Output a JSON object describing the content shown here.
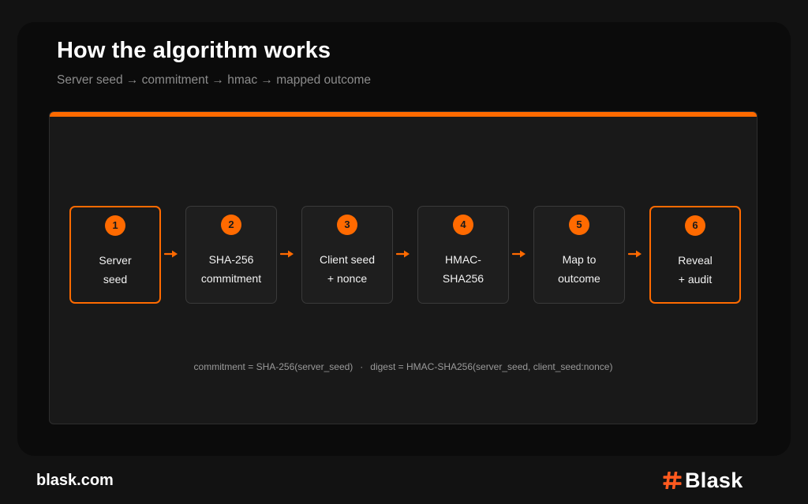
{
  "header": {
    "title": "How the algorithm works",
    "subtitle": "Server seed → commitment → hmac → mapped outcome"
  },
  "colors": {
    "accent": "#ff6a00",
    "background": "#121212",
    "card": "#0b0b0b",
    "panel": "#191919"
  },
  "steps": [
    {
      "number": "1",
      "line1": "Server",
      "line2": "seed",
      "highlight": true
    },
    {
      "number": "2",
      "line1": "SHA-256",
      "line2": "commitment",
      "highlight": false
    },
    {
      "number": "3",
      "line1": "Client seed",
      "line2": "+ nonce",
      "highlight": false
    },
    {
      "number": "4",
      "line1": "HMAC-",
      "line2": "SHA256",
      "highlight": false
    },
    {
      "number": "5",
      "line1": "Map to",
      "line2": "outcome",
      "highlight": false
    },
    {
      "number": "6",
      "line1": "Reveal",
      "line2": "+ audit",
      "highlight": true
    }
  ],
  "formula": {
    "commitment": "commitment = SHA-256(server_seed)",
    "separator": "·",
    "digest": "digest = HMAC-SHA256(server_seed, client_seed:nonce)"
  },
  "footer": {
    "site": "blask.com",
    "logo_text": "Blask",
    "logo_icon": "hash-icon"
  }
}
